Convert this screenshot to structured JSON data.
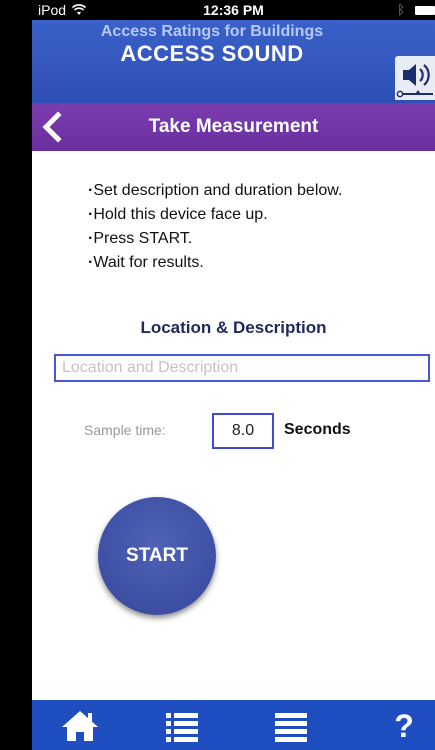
{
  "status_bar": {
    "carrier": "iPod",
    "time": "12:36 PM"
  },
  "header": {
    "subtitle": "Access Ratings for Buildings",
    "title": "ACCESS SOUND",
    "brand_color": "#3a61c9"
  },
  "nav": {
    "title": "Take Measurement",
    "back_icon": "chevron-left-icon",
    "accent": "#7a3db0"
  },
  "instructions": [
    "Set description and duration below.",
    "Hold this device face up.",
    "Press START.",
    "Wait for results."
  ],
  "location": {
    "heading": "Location & Description",
    "placeholder": "Location and Description",
    "value": ""
  },
  "sample": {
    "label": "Sample time:",
    "value": "8.0",
    "unit": "Seconds"
  },
  "start_button": {
    "label": "START",
    "color": "#4257ad"
  },
  "tabs": [
    {
      "icon": "home-icon"
    },
    {
      "icon": "list-icon"
    },
    {
      "icon": "menu-icon"
    },
    {
      "icon": "help-icon",
      "label": "?"
    }
  ]
}
